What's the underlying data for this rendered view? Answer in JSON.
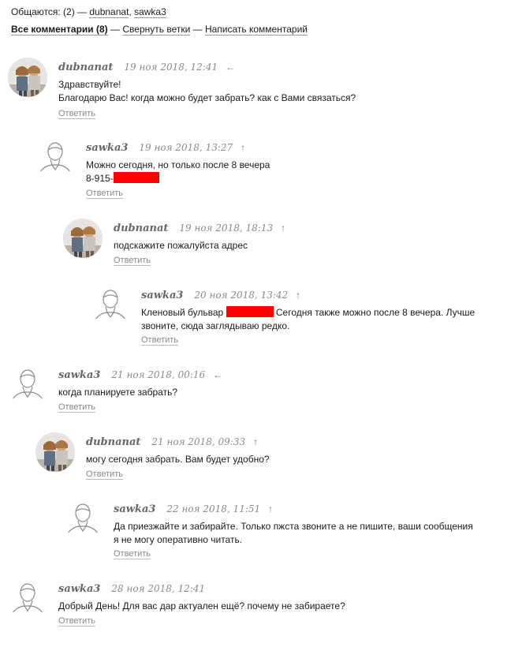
{
  "header": {
    "participants_label": "Общаются: (2) — ",
    "participant_1": "dubnanat",
    "sep": ", ",
    "participant_2": "sawka3",
    "all_comments": "Все комментарии (8)",
    "dash1": " — ",
    "collapse": "Свернуть ветки",
    "dash2": " — ",
    "write": "Написать комментарий"
  },
  "reply_label": "Ответить",
  "colors": {
    "redaction": "#ff0000",
    "author": "#666666",
    "date": "#8a8a8a"
  },
  "comments": [
    {
      "author": "dubnanat",
      "date": "19 ноя 2018, 12:41",
      "arrow": "←",
      "avatar": "photo",
      "line1": "Здравствуйте!",
      "line2": "Благодарю Вас! когда можно будет забрать? как с Вами связаться?"
    },
    {
      "author": "sawka3",
      "date": "19 ноя 2018, 13:27",
      "arrow": "↑",
      "avatar": "default-user-icon",
      "line1": "Можно сегодня, но только после 8 вечера",
      "line2": "8-915-"
    },
    {
      "author": "dubnanat",
      "date": "19 ноя 2018, 18:13",
      "arrow": "↑",
      "avatar": "photo",
      "line1": "подскажите пожалуйста адрес"
    },
    {
      "author": "sawka3",
      "date": "20 ноя 2018, 13:42",
      "arrow": "↑",
      "avatar": "default-user-icon",
      "line1a": "Кленовый бульвар ",
      "line1b": " Сегодня также можно после 8 вечера. Лучше",
      "line2": "звоните, сюда заглядываю редко."
    },
    {
      "author": "sawka3",
      "date": "21 ноя 2018, 00:16",
      "arrow": "←",
      "avatar": "default-user-icon",
      "line1": "когда планируете забрать?"
    },
    {
      "author": "dubnanat",
      "date": "21 ноя 2018, 09:33",
      "arrow": "↑",
      "avatar": "photo",
      "line1": "могу сегодня забрать. Вам будет удобно?"
    },
    {
      "author": "sawka3",
      "date": "22 ноя 2018, 11:51",
      "arrow": "↑",
      "avatar": "default-user-icon",
      "line1": "Да приезжайте и забирайте. Только пжста звоните а не пишите, ваши сообщения",
      "line2": "я не могу оперативно читать."
    },
    {
      "author": "sawka3",
      "date": "28 ноя 2018, 12:41",
      "arrow": "",
      "avatar": "default-user-icon",
      "line1": "Добрый День! Для вас дар актуален ещё? почему не забираете?"
    }
  ]
}
